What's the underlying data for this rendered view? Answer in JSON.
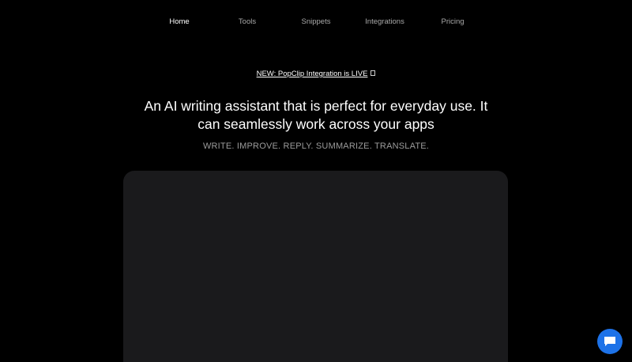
{
  "nav": {
    "items": [
      {
        "label": "Home",
        "active": true
      },
      {
        "label": "Tools",
        "active": false
      },
      {
        "label": "Snippets",
        "active": false
      },
      {
        "label": "Integrations",
        "active": false
      },
      {
        "label": "Pricing",
        "active": false
      }
    ]
  },
  "hero": {
    "announcement": "NEW: PopClip Integration is LIVE",
    "announcement_icon": "external-link-icon",
    "headline": "An AI writing assistant that is perfect for everyday use. It can seamlessly work across your apps",
    "tagline": "WRITE. IMPROVE. REPLY. SUMMARIZE. TRANSLATE."
  },
  "chat": {
    "icon": "chat-bubble-icon",
    "color": "#1d72e8"
  },
  "colors": {
    "background": "#000000",
    "panel": "#1a1a1c",
    "nav_inactive": "#a9a9a9",
    "tagline": "#9b9b9b"
  }
}
